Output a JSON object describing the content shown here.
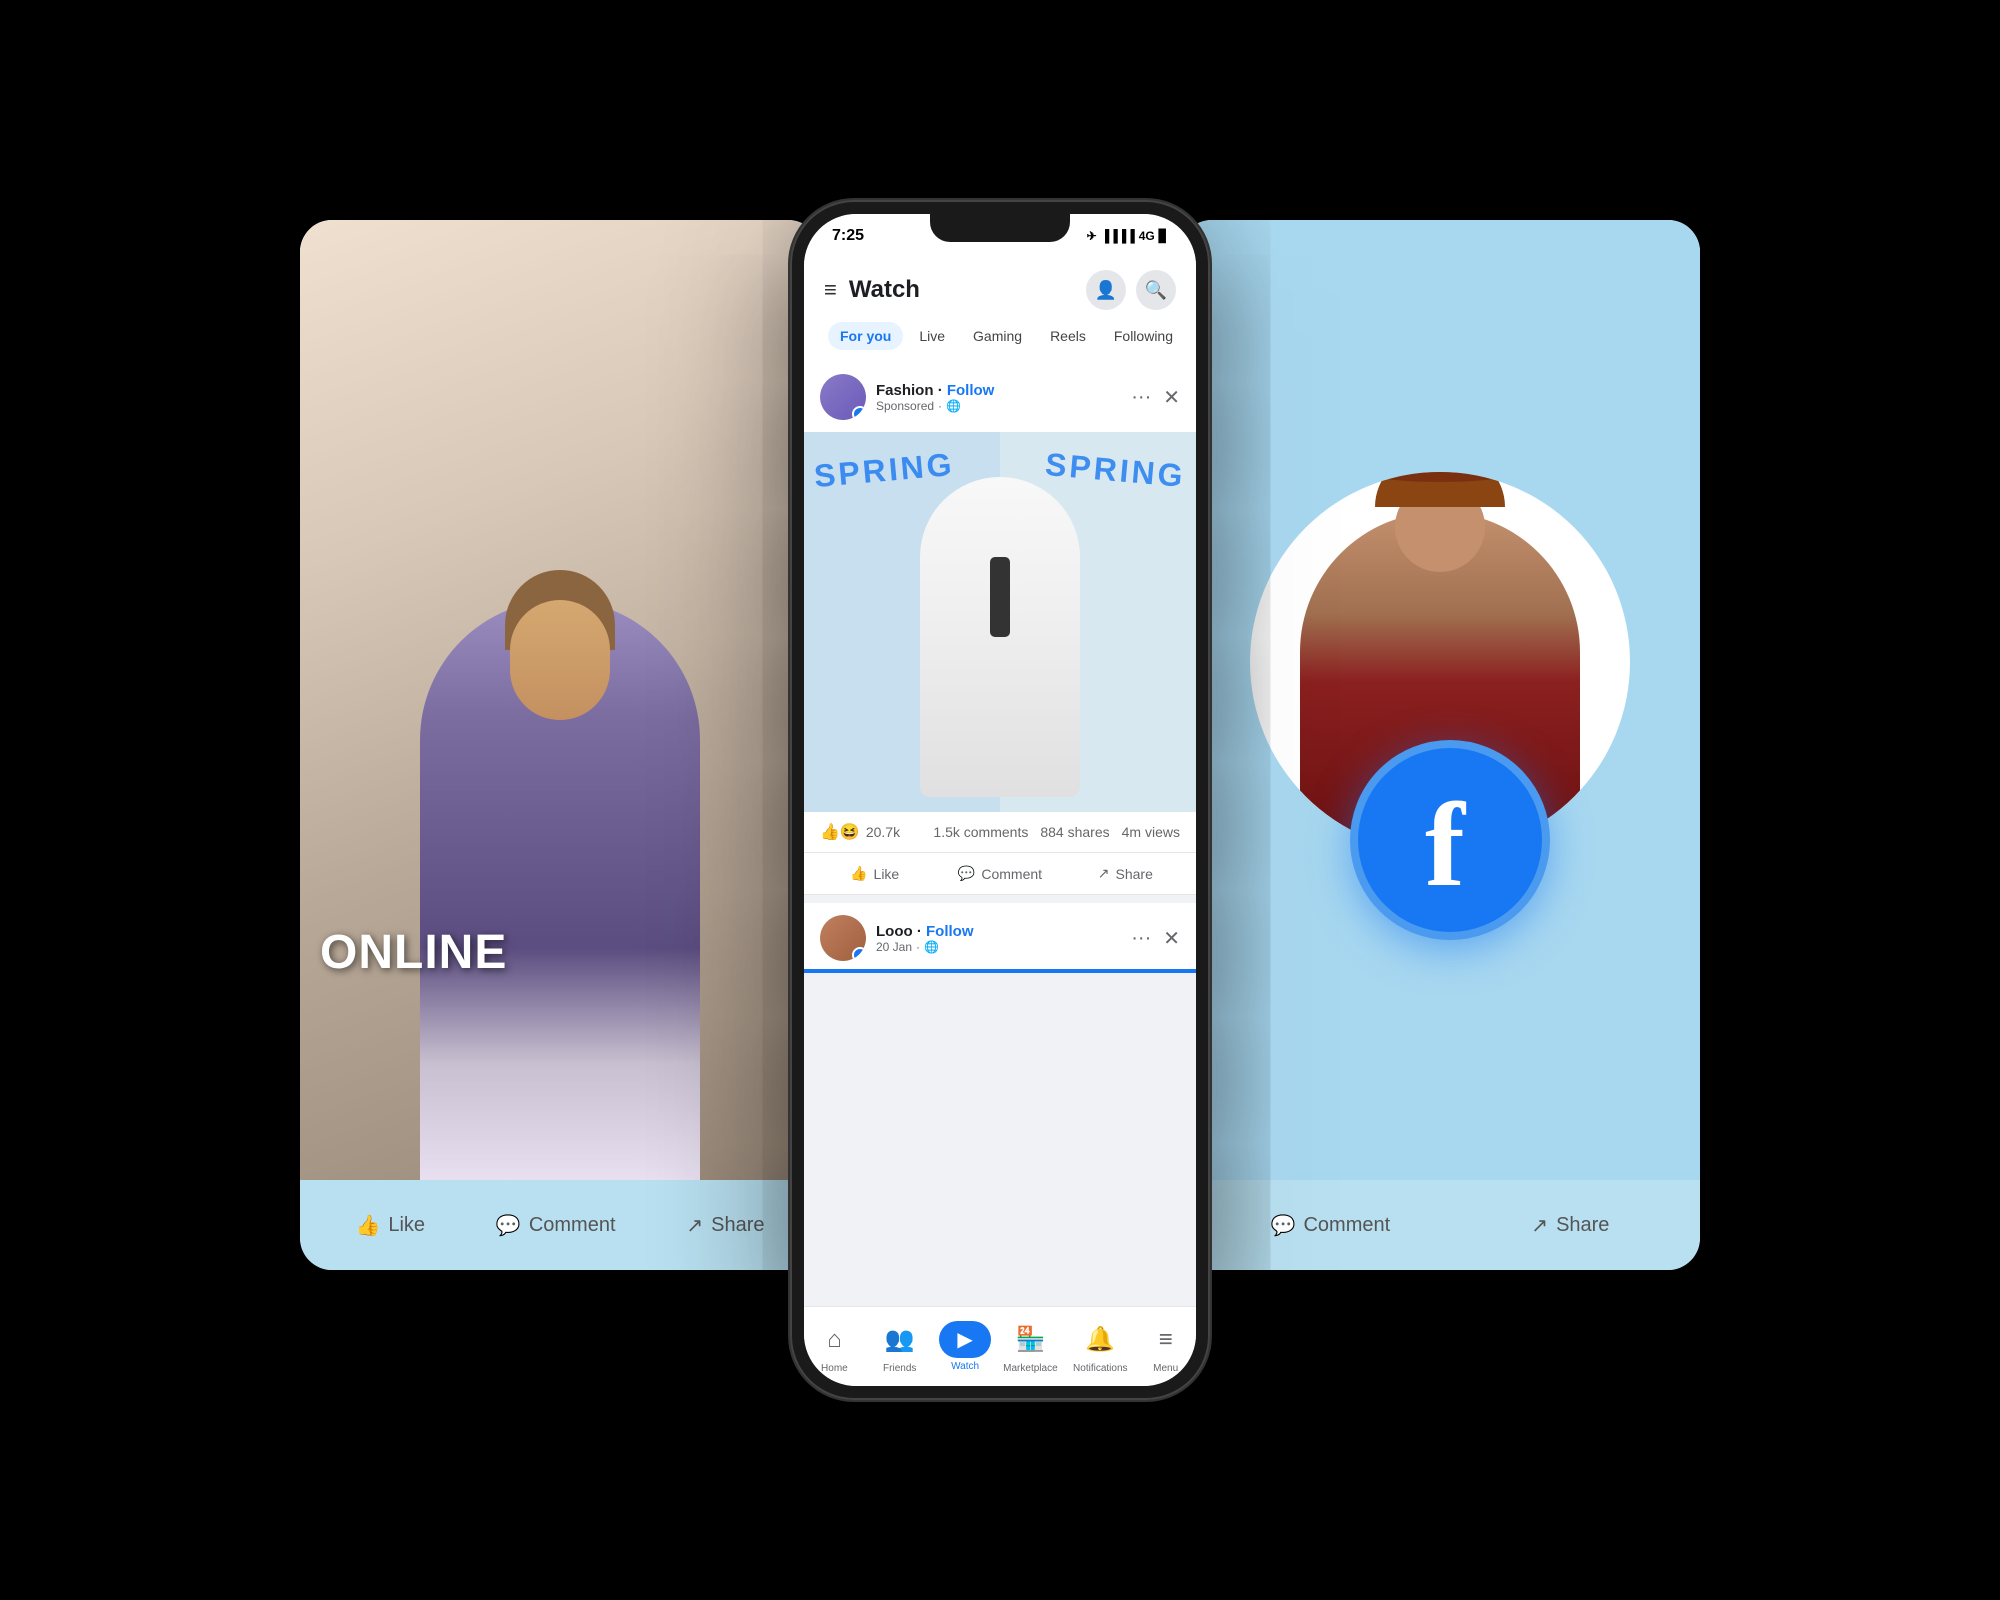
{
  "status_bar": {
    "time": "7:25",
    "signal": "4G",
    "battery": "🔋"
  },
  "app_header": {
    "title": "Watch",
    "hamburger": "≡"
  },
  "tabs": [
    {
      "label": "For you",
      "active": true
    },
    {
      "label": "Live",
      "active": false
    },
    {
      "label": "Gaming",
      "active": false
    },
    {
      "label": "Reels",
      "active": false
    },
    {
      "label": "Following",
      "active": false
    }
  ],
  "post1": {
    "author": "Fashion",
    "follow_label": "Follow",
    "subtitle": "Sponsored",
    "visibility": "🌐",
    "reactions": "20.7k",
    "comments": "1.5k comments",
    "shares": "884 shares",
    "views": "4m views",
    "like_label": "Like",
    "comment_label": "Comment",
    "share_label": "Share",
    "spring_text_1": "SPRING",
    "spring_text_2": "SPRING"
  },
  "post2": {
    "author": "Looo",
    "follow_label": "Follow",
    "date": "20 Jan",
    "visibility": "🌐"
  },
  "bottom_nav": [
    {
      "label": "Home",
      "icon": "⌂",
      "active": false
    },
    {
      "label": "Friends",
      "icon": "👥",
      "active": false
    },
    {
      "label": "Watch",
      "icon": "▶",
      "active": true
    },
    {
      "label": "Marketplace",
      "icon": "🏪",
      "active": false
    },
    {
      "label": "Notifications",
      "icon": "🔔",
      "active": false
    },
    {
      "label": "Menu",
      "icon": "≡",
      "active": false
    }
  ],
  "left_card": {
    "online_text": "ONLINE",
    "like_label": "Like",
    "comment_label": "Comment",
    "share_label": "Share"
  },
  "right_card": {
    "comment_label": "Comment",
    "share_label": "Share"
  },
  "facebook_logo": "f"
}
